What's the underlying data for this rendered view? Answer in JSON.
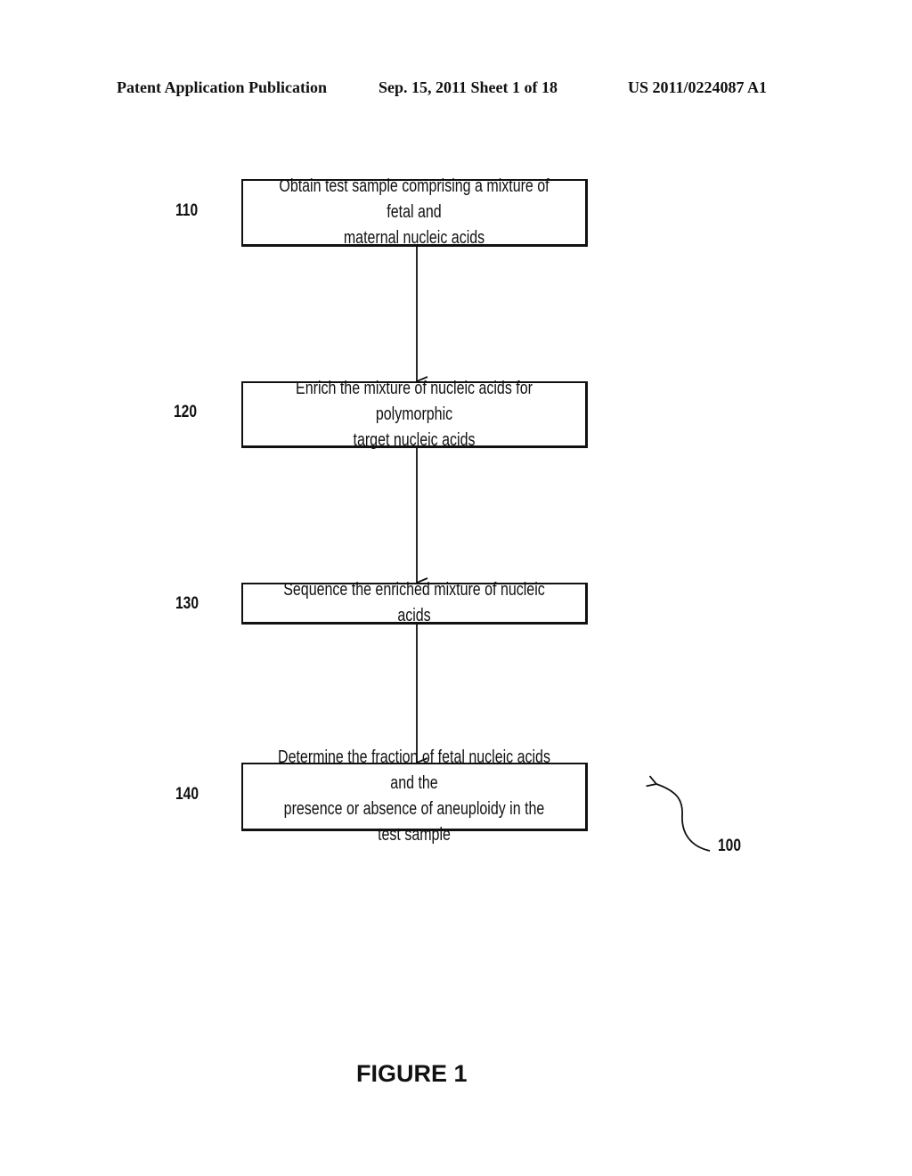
{
  "header": {
    "publication": "Patent Application Publication",
    "date_sheet": "Sep. 15, 2011   Sheet 1 of 18",
    "patent_number": "US 2011/0224087 A1"
  },
  "flowchart": {
    "steps": [
      {
        "ref": "110",
        "text": "Obtain test sample comprising a mixture of fetal and\nmaternal nucleic acids"
      },
      {
        "ref": "120",
        "text": "Enrich the mixture of nucleic acids  for  polymorphic\ntarget nucleic acids"
      },
      {
        "ref": "130",
        "text": "Sequence the enriched mixture  of nucleic acids"
      },
      {
        "ref": "140",
        "text": "Determine the fraction of fetal nucleic acids  and the\npresence or absence of aneuploidy in the test sample"
      }
    ],
    "overall_ref": "100"
  },
  "caption": "FIGURE 1"
}
